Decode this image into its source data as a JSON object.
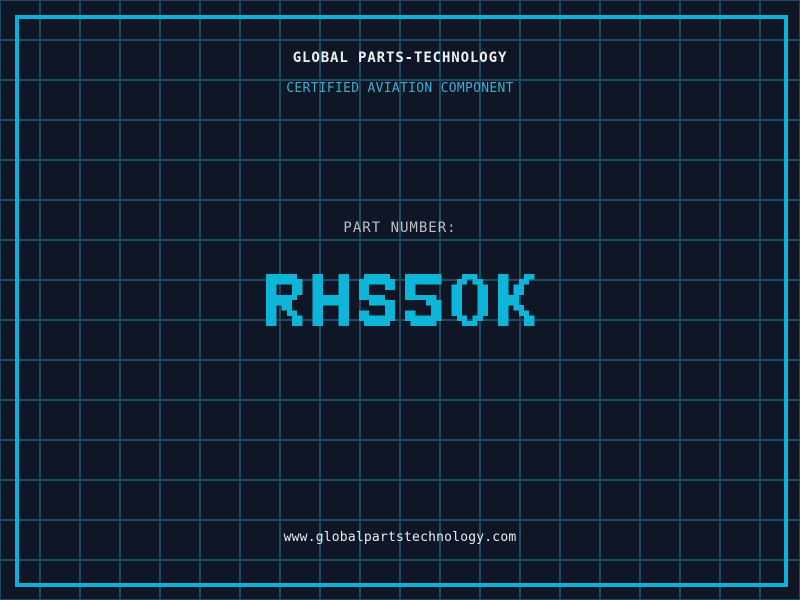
{
  "colors": {
    "background": "#0f1726",
    "grid_line": "#1d4d63",
    "frame": "#0db0d8",
    "title_text": "#eef1f4",
    "subtitle_text": "#3fadd0",
    "label_text": "#b9c0ca",
    "part_number_text": "#0db5d9",
    "url_text": "#e9ecef"
  },
  "header": {
    "title": "GLOBAL PARTS-TECHNOLOGY",
    "subtitle": "CERTIFIED AVIATION COMPONENT"
  },
  "part_number": {
    "label": "PART NUMBER:",
    "value": "RHS5OK"
  },
  "footer": {
    "website": "www.globalpartstechnology.com"
  }
}
